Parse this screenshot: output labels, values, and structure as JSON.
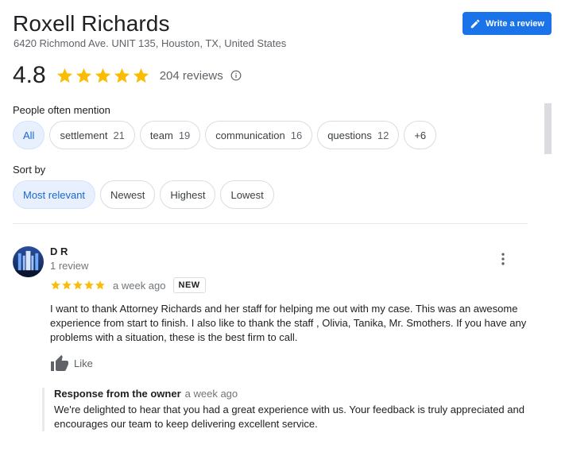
{
  "header": {
    "title": "Roxell Richards",
    "address": "6420 Richmond Ave. UNIT 135, Houston, TX, United States",
    "write_review_label": "Write a review"
  },
  "rating": {
    "score": "4.8",
    "stars": 5,
    "review_count": "204 reviews",
    "star_color": "#fbbc04"
  },
  "mentions": {
    "label": "People often mention",
    "chips": [
      {
        "label": "All",
        "count": ""
      },
      {
        "label": "settlement",
        "count": "21"
      },
      {
        "label": "team",
        "count": "19"
      },
      {
        "label": "communication",
        "count": "16"
      },
      {
        "label": "questions",
        "count": "12"
      },
      {
        "label": "+6",
        "count": ""
      }
    ]
  },
  "sort": {
    "label": "Sort by",
    "options": [
      "Most relevant",
      "Newest",
      "Highest",
      "Lowest"
    ]
  },
  "review": {
    "name": "D R",
    "subtitle": "1 review",
    "stars": 5,
    "time": "a week ago",
    "badge": "NEW",
    "text": "I want to thank Attorney Richards and her staff for helping me out with my case. This was an awesome experience from start to finish. I also like to thank the staff , Olivia, Tanika, Mr. Smothers. If you have any problems with a situation, these is the best firm to call.",
    "like_label": "Like",
    "owner_response": {
      "label": "Response from the owner",
      "time": "a week ago",
      "text": "We're delighted to hear that you had a great experience with us. Your feedback is truly appreciated and encourages our team to keep delivering excellent service."
    }
  },
  "colors": {
    "accent": "#1a73e8",
    "chip_selected_bg": "#e8f0fe",
    "chip_selected_text": "#1967d2"
  }
}
